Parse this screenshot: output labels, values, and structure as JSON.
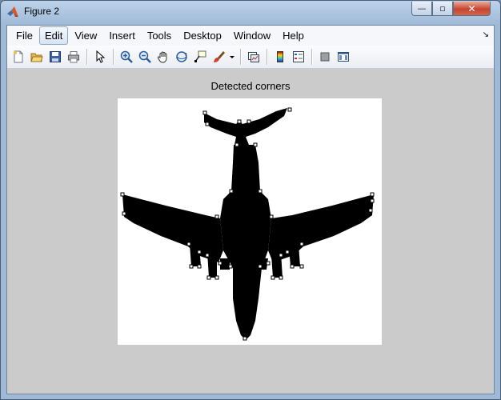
{
  "window": {
    "title": "Figure 2",
    "min_symbol": "—",
    "max_symbol": "▫",
    "close_symbol": "✕"
  },
  "menubar": {
    "items": [
      {
        "label": "File",
        "active": false
      },
      {
        "label": "Edit",
        "active": true
      },
      {
        "label": "View",
        "active": false
      },
      {
        "label": "Insert",
        "active": false
      },
      {
        "label": "Tools",
        "active": false
      },
      {
        "label": "Desktop",
        "active": false
      },
      {
        "label": "Window",
        "active": false
      },
      {
        "label": "Help",
        "active": false
      }
    ],
    "dock_arrow": "↘"
  },
  "toolbar": {
    "icons": [
      "new-figure-icon",
      "open-file-icon",
      "save-figure-icon",
      "print-figure-icon",
      "|",
      "edit-plot-icon",
      "|",
      "zoom-in-icon",
      "zoom-out-icon",
      "pan-icon",
      "rotate-3d-icon",
      "data-cursor-icon",
      "brush-icon",
      "|",
      "link-plot-icon",
      "|",
      "insert-colorbar-icon",
      "insert-legend-icon",
      "|",
      "hide-plot-tools-icon",
      "show-plot-tools-icon"
    ]
  },
  "axes": {
    "title": "Detected corners"
  },
  "colors": {
    "figure_background": "#cbcbcb",
    "silhouette": "#000000",
    "corner_marker": "#ffffff"
  }
}
